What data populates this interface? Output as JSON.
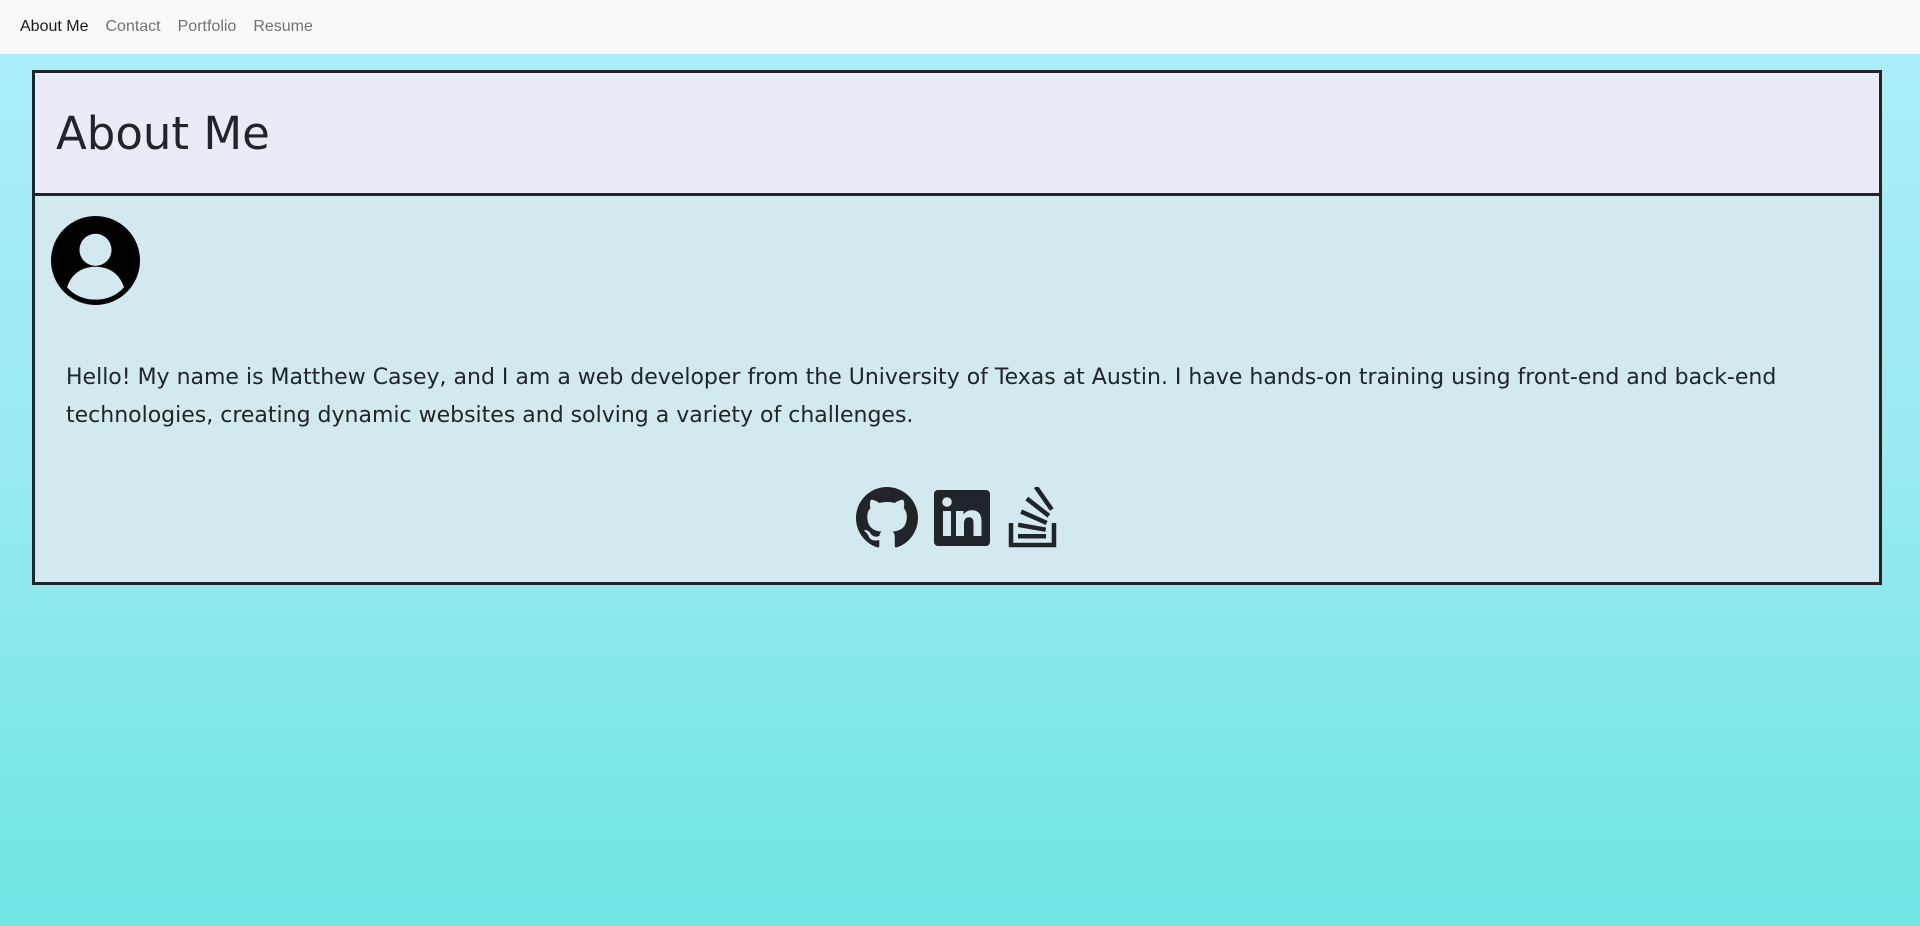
{
  "navbar": {
    "links": [
      {
        "label": "About Me",
        "active": true
      },
      {
        "label": "Contact",
        "active": false
      },
      {
        "label": "Portfolio",
        "active": false
      },
      {
        "label": "Resume",
        "active": false
      }
    ]
  },
  "about": {
    "title": "About Me",
    "bio": "Hello! My name is Matthew Casey, and I am a web developer from the University of Texas at Austin. I have hands-on training using front-end and back-end technologies, creating dynamic websites and solving a variety of challenges."
  },
  "socials": [
    {
      "icon": "github-icon"
    },
    {
      "icon": "linkedin-icon"
    },
    {
      "icon": "stackoverflow-icon"
    }
  ],
  "colors": {
    "text": "#212529",
    "header_bg": "#e9ebf6",
    "body_bg": "#d2e9f0",
    "navbar_bg": "#f8f9fa"
  }
}
